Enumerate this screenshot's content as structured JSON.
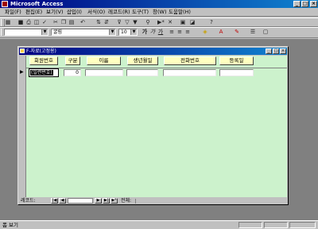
{
  "app": {
    "title": "Microsoft Access",
    "window_buttons": {
      "minimize": "_",
      "maximize": "□",
      "close": "×"
    }
  },
  "menu": {
    "items": [
      "파일(F)",
      "편집(E)",
      "보기(V)",
      "삽입(I)",
      "서식(O)",
      "레코드(R)",
      "도구(T)",
      "창(W)",
      "도움말(H)"
    ]
  },
  "format_toolbar": {
    "font_name": "굴림",
    "font_size": "10"
  },
  "form": {
    "title": "F-자료(고정용)",
    "headers": [
      "회원번호",
      "구분",
      "이름",
      "생년월일",
      "전화번호",
      "등록일"
    ],
    "record": {
      "member_no": "(일련번호)",
      "category": "0",
      "name": "",
      "birth": "",
      "phone": "",
      "reg_date": ""
    },
    "current_record_marker": "▶"
  },
  "navigation": {
    "label": "레코드:",
    "record_number": "",
    "total_label": "전체:",
    "buttons": {
      "first": "|◀",
      "prev": "◀",
      "next": "▶",
      "last": "▶|",
      "new": "▶*"
    }
  },
  "status": {
    "text": "폼 보기"
  },
  "icons": [
    "app-icon",
    "save-icon",
    "print-icon",
    "preview-icon",
    "spell-icon",
    "cut-icon",
    "copy-icon",
    "paste-icon",
    "undo-icon",
    "sort-icon",
    "filter-icon",
    "find-icon",
    "new-record-icon",
    "delete-record-icon",
    "bold-icon",
    "italic-icon",
    "underline-icon",
    "align-left-icon",
    "align-center-icon",
    "align-right-icon",
    "fill-color-icon",
    "font-color-icon",
    "line-color-icon",
    "form-icon"
  ]
}
